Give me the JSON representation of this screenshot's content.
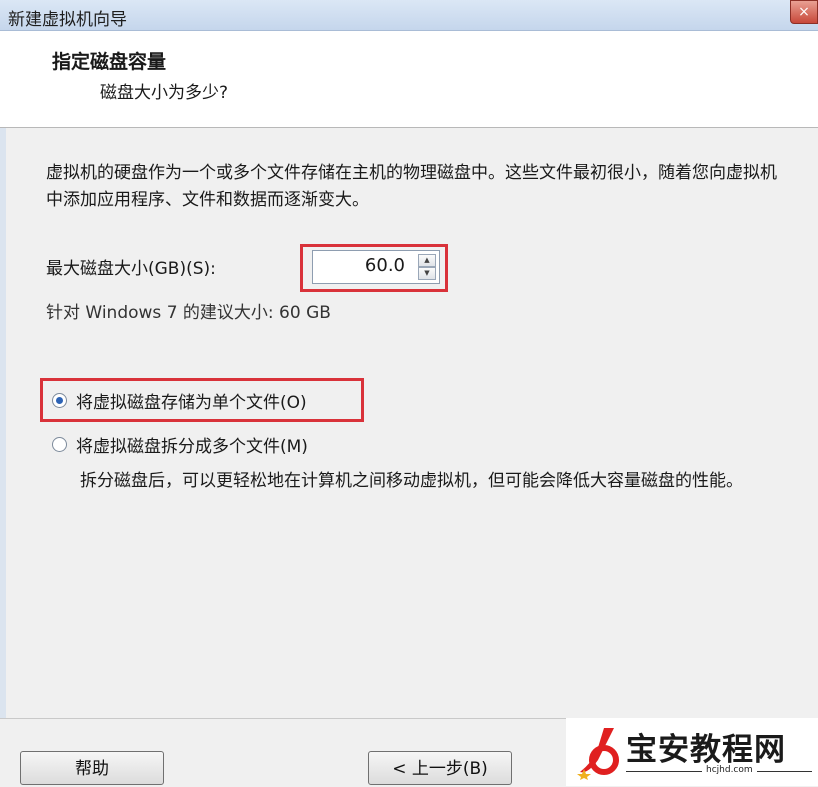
{
  "window": {
    "title": "新建虚拟机向导",
    "close_label": "×"
  },
  "header": {
    "title": "指定磁盘容量",
    "subtitle": "磁盘大小为多少?"
  },
  "content": {
    "description": "虚拟机的硬盘作为一个或多个文件存储在主机的物理磁盘中。这些文件最初很小，随着您向虚拟机中添加应用程序、文件和数据而逐渐变大。",
    "max_disk_label": "最大磁盘大小(GB)(S):",
    "max_disk_value": "60.0",
    "recommendation": "针对 Windows 7 的建议大小: 60 GB",
    "options": [
      {
        "label": "将虚拟磁盘存储为单个文件(O)",
        "checked": true
      },
      {
        "label": "将虚拟磁盘拆分成多个文件(M)",
        "checked": false
      }
    ],
    "split_description": "拆分磁盘后，可以更轻松地在计算机之间移动虚拟机，但可能会降低大容量磁盘的性能。"
  },
  "footer": {
    "help_label": "帮助",
    "back_label": "< 上一步(B)"
  },
  "watermark": {
    "text": "宝安教程网",
    "url": "hcjhd.com"
  },
  "colors": {
    "highlight": "#d9323a",
    "accent": "#2d63b5",
    "logo_red": "#e02020"
  }
}
